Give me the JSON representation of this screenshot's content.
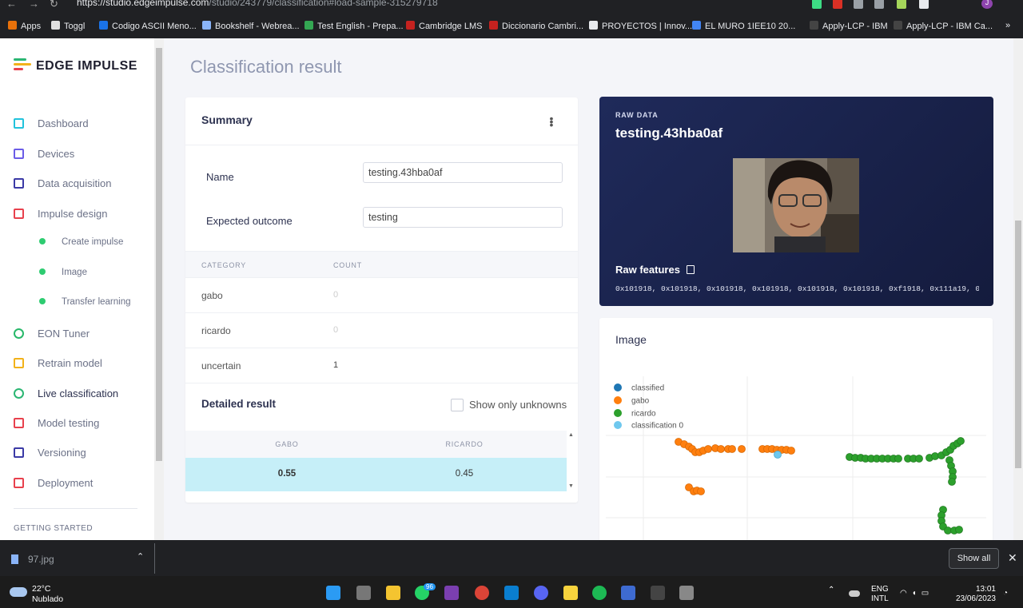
{
  "browser": {
    "url_host": "https://studio.edgeimpulse.com",
    "url_path": "/studio/243779/classification#load-sample-315279718",
    "bookmarks": [
      {
        "label": "Apps",
        "color": "#e8710a"
      },
      {
        "label": "Toggl",
        "color": "#e0e0e0"
      },
      {
        "label": "Codigo ASCII Meno...",
        "color": "#1a73e8"
      },
      {
        "label": "Bookshelf - Webrea...",
        "color": "#8ab4f8"
      },
      {
        "label": "Test English - Prepa...",
        "color": "#34a853"
      },
      {
        "label": "Cambridge LMS",
        "color": "#c5221f"
      },
      {
        "label": "Diccionario Cambri...",
        "color": "#c5221f"
      },
      {
        "label": "PROYECTOS | Innov...",
        "color": "#e8eaed"
      },
      {
        "label": "EL MURO 1IEE10 20...",
        "color": "#4285f4"
      },
      {
        "label": "Apply-LCP - IBM",
        "color": "#444"
      },
      {
        "label": "Apply-LCP - IBM Ca...",
        "color": "#444"
      }
    ],
    "more": "»",
    "profile_initial": "J"
  },
  "sidebar": {
    "brand": "EDGE IMPULSE",
    "items": [
      {
        "label": "Dashboard",
        "icon": "monitor-icon",
        "color": "#22c3dc"
      },
      {
        "label": "Devices",
        "icon": "chip-icon",
        "color": "#6b5ce7"
      },
      {
        "label": "Data acquisition",
        "icon": "database-icon",
        "color": "#3b3aa6"
      },
      {
        "label": "Impulse design",
        "icon": "pulse-icon",
        "color": "#e8414d"
      },
      {
        "label": "EON Tuner",
        "icon": "tuner-icon",
        "color": "#28b86a"
      },
      {
        "label": "Retrain model",
        "icon": "shuffle-icon",
        "color": "#f2b21a"
      },
      {
        "label": "Live classification",
        "icon": "graph-icon",
        "color": "#2bb673"
      },
      {
        "label": "Model testing",
        "icon": "flask-icon",
        "color": "#e8414d"
      },
      {
        "label": "Versioning",
        "icon": "branch-icon",
        "color": "#3b3aa6"
      },
      {
        "label": "Deployment",
        "icon": "box-icon",
        "color": "#e8414d"
      }
    ],
    "subitems": [
      "Create impulse",
      "Image",
      "Transfer learning"
    ],
    "getting_started": "GETTING STARTED"
  },
  "main": {
    "page_title": "Classification result",
    "summary": {
      "title": "Summary",
      "name_label": "Name",
      "name_value": "testing.43hba0af",
      "expected_label": "Expected outcome",
      "expected_value": "testing",
      "col_category": "CATEGORY",
      "col_count": "COUNT",
      "rows": [
        {
          "category": "gabo",
          "count": "0"
        },
        {
          "category": "ricardo",
          "count": "0"
        },
        {
          "category": "uncertain",
          "count": "1"
        }
      ],
      "detailed_title": "Detailed result",
      "show_unknowns": "Show only unknowns",
      "detail_headers": [
        "GABO",
        "RICARDO"
      ],
      "detail_values": [
        "0.55",
        "0.45"
      ]
    },
    "raw": {
      "label": "RAW DATA",
      "name": "testing.43hba0af",
      "features_label": "Raw features",
      "features": "0x101918, 0x101918, 0x101918, 0x101918, 0x101918, 0x101918, 0xf1918, 0x111a19, 0…"
    },
    "image_card": {
      "title": "Image",
      "legend": [
        {
          "label": "classified",
          "color": "#1f77b4"
        },
        {
          "label": "gabo",
          "color": "#ff7f0e"
        },
        {
          "label": "ricardo",
          "color": "#2ca02c"
        },
        {
          "label": "classification 0",
          "color": "#6fc8ee"
        }
      ]
    }
  },
  "downloads": {
    "file": "97.jpg",
    "show_all": "Show all"
  },
  "taskbar": {
    "temp": "22°C",
    "weather": "Nublado",
    "whatsapp_badge": "96",
    "lang1": "ENG",
    "lang2": "INTL",
    "time": "13:01",
    "date": "23/06/2023"
  },
  "chart_data": {
    "type": "scatter",
    "series": [
      {
        "name": "gabo",
        "points": [
          [
            849,
            553
          ],
          [
            856,
            556
          ],
          [
            862,
            559
          ],
          [
            866,
            562
          ],
          [
            870,
            566
          ],
          [
            875,
            566
          ],
          [
            880,
            564
          ],
          [
            886,
            562
          ],
          [
            895,
            561
          ],
          [
            902,
            562
          ],
          [
            911,
            562
          ],
          [
            916,
            562
          ],
          [
            928,
            562
          ],
          [
            954,
            562
          ],
          [
            960,
            562
          ],
          [
            966,
            562
          ],
          [
            972,
            563
          ],
          [
            978,
            563
          ],
          [
            984,
            563
          ],
          [
            990,
            564
          ],
          [
            862,
            610
          ],
          [
            868,
            615
          ],
          [
            872,
            614
          ],
          [
            877,
            615
          ]
        ]
      },
      {
        "name": "ricardo",
        "points": [
          [
            1063,
            572
          ],
          [
            1070,
            573
          ],
          [
            1077,
            573
          ],
          [
            1083,
            574
          ],
          [
            1090,
            574
          ],
          [
            1097,
            574
          ],
          [
            1104,
            574
          ],
          [
            1111,
            574
          ],
          [
            1118,
            574
          ],
          [
            1124,
            574
          ],
          [
            1136,
            574
          ],
          [
            1143,
            574
          ],
          [
            1150,
            574
          ],
          [
            1163,
            573
          ],
          [
            1170,
            571
          ],
          [
            1178,
            570
          ],
          [
            1184,
            566
          ],
          [
            1189,
            563
          ],
          [
            1193,
            558
          ],
          [
            1198,
            555
          ],
          [
            1202,
            552
          ],
          [
            1188,
            576
          ],
          [
            1190,
            583
          ],
          [
            1192,
            590
          ],
          [
            1192,
            597
          ],
          [
            1191,
            603
          ],
          [
            1180,
            638
          ],
          [
            1178,
            645
          ],
          [
            1178,
            652
          ],
          [
            1180,
            659
          ],
          [
            1186,
            664
          ],
          [
            1194,
            664
          ],
          [
            1200,
            663
          ]
        ]
      },
      {
        "name": "classification 0",
        "points": [
          [
            973,
            569
          ]
        ]
      }
    ]
  }
}
